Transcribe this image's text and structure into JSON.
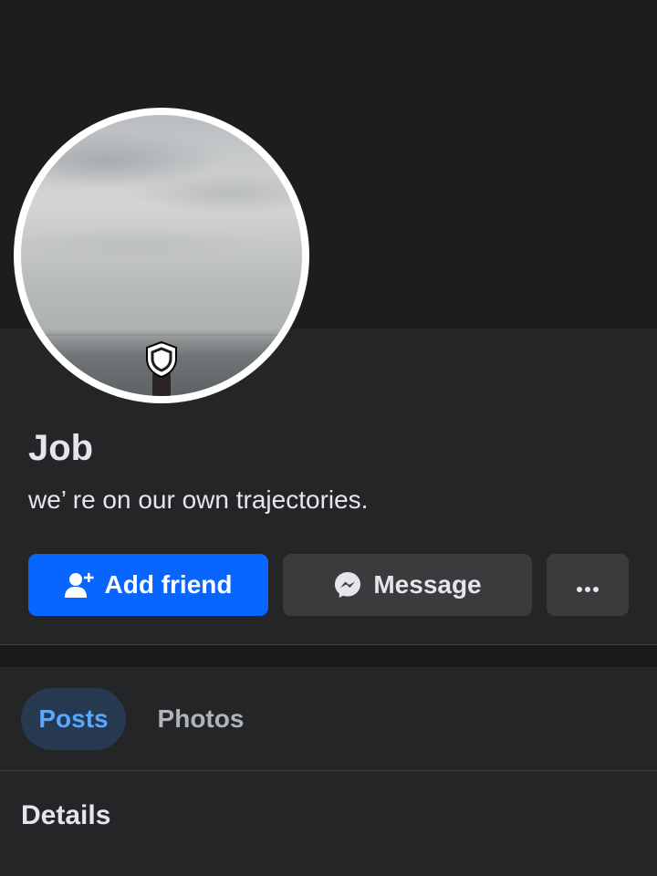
{
  "profile": {
    "name": "Job",
    "bio": "we’ re on our own trajectories."
  },
  "actions": {
    "add_friend_label": "Add friend",
    "message_label": "Message",
    "more_label": "•••"
  },
  "tabs": [
    {
      "label": "Posts",
      "selected": true
    },
    {
      "label": "Photos",
      "selected": false
    }
  ],
  "sections": {
    "details_title": "Details"
  },
  "colors": {
    "accent": "#0866ff",
    "background": "#242526",
    "selected_tab_bg": "#263951",
    "selected_tab_text": "#5aa7ff"
  },
  "icons": {
    "add_friend": "person-plus-icon",
    "message": "messenger-icon",
    "more": "more-dots-icon",
    "profile_guard": "shield-icon"
  }
}
